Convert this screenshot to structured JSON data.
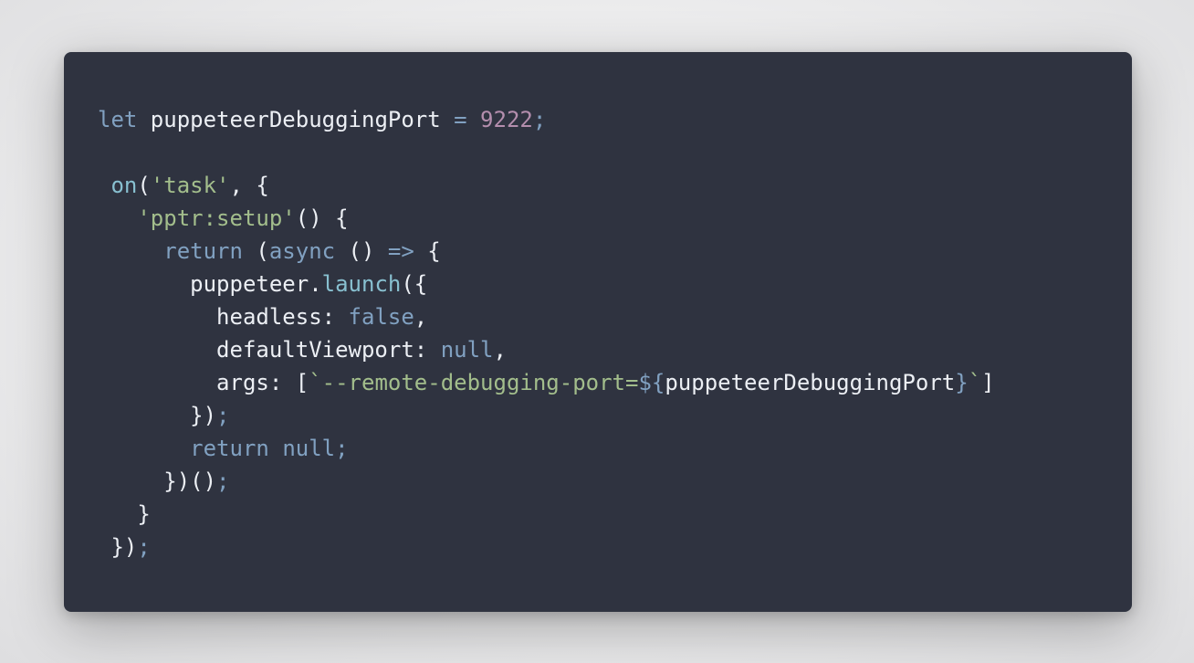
{
  "colors": {
    "background": "#ececed",
    "editor_background": "#2f3340",
    "keyword": "#81a1c1",
    "function": "#88c0d0",
    "string": "#a3be8c",
    "number": "#b48ead",
    "text": "#eceff4"
  },
  "code": {
    "language": "javascript",
    "lines": [
      [
        {
          "t": "let",
          "c": "kw"
        },
        {
          "t": " puppeteerDebuggingPort ",
          "c": "ident"
        },
        {
          "t": "=",
          "c": "op"
        },
        {
          "t": " ",
          "c": "ident"
        },
        {
          "t": "9222",
          "c": "num"
        },
        {
          "t": ";",
          "c": "op"
        }
      ],
      [],
      [
        {
          "t": " ",
          "c": "ident"
        },
        {
          "t": "on",
          "c": "fn"
        },
        {
          "t": "(",
          "c": "punc"
        },
        {
          "t": "'task'",
          "c": "str"
        },
        {
          "t": ", {",
          "c": "punc"
        }
      ],
      [
        {
          "t": "   ",
          "c": "ident"
        },
        {
          "t": "'pptr:setup'",
          "c": "str"
        },
        {
          "t": "() {",
          "c": "punc"
        }
      ],
      [
        {
          "t": "     ",
          "c": "ident"
        },
        {
          "t": "return",
          "c": "kw"
        },
        {
          "t": " (",
          "c": "punc"
        },
        {
          "t": "async",
          "c": "kw"
        },
        {
          "t": " () ",
          "c": "punc"
        },
        {
          "t": "=>",
          "c": "op"
        },
        {
          "t": " {",
          "c": "punc"
        }
      ],
      [
        {
          "t": "       puppeteer",
          "c": "ident"
        },
        {
          "t": ".",
          "c": "punc"
        },
        {
          "t": "launch",
          "c": "fn"
        },
        {
          "t": "({",
          "c": "punc"
        }
      ],
      [
        {
          "t": "         headless",
          "c": "ident"
        },
        {
          "t": ":",
          "c": "punc"
        },
        {
          "t": " ",
          "c": "ident"
        },
        {
          "t": "false",
          "c": "kw"
        },
        {
          "t": ",",
          "c": "punc"
        }
      ],
      [
        {
          "t": "         defaultViewport",
          "c": "ident"
        },
        {
          "t": ":",
          "c": "punc"
        },
        {
          "t": " ",
          "c": "ident"
        },
        {
          "t": "null",
          "c": "kw"
        },
        {
          "t": ",",
          "c": "punc"
        }
      ],
      [
        {
          "t": "         args",
          "c": "ident"
        },
        {
          "t": ":",
          "c": "punc"
        },
        {
          "t": " [",
          "c": "punc"
        },
        {
          "t": "`--remote-debugging-port=",
          "c": "str"
        },
        {
          "t": "${",
          "c": "kw"
        },
        {
          "t": "puppeteerDebuggingPort",
          "c": "ident"
        },
        {
          "t": "}",
          "c": "kw"
        },
        {
          "t": "`",
          "c": "str"
        },
        {
          "t": "]",
          "c": "punc"
        }
      ],
      [
        {
          "t": "       })",
          "c": "punc"
        },
        {
          "t": ";",
          "c": "op"
        }
      ],
      [
        {
          "t": "       ",
          "c": "ident"
        },
        {
          "t": "return",
          "c": "kw"
        },
        {
          "t": " ",
          "c": "ident"
        },
        {
          "t": "null",
          "c": "kw"
        },
        {
          "t": ";",
          "c": "op"
        }
      ],
      [
        {
          "t": "     })()",
          "c": "punc"
        },
        {
          "t": ";",
          "c": "op"
        }
      ],
      [
        {
          "t": "   }",
          "c": "punc"
        }
      ],
      [
        {
          "t": " })",
          "c": "punc"
        },
        {
          "t": ";",
          "c": "op"
        }
      ]
    ]
  }
}
